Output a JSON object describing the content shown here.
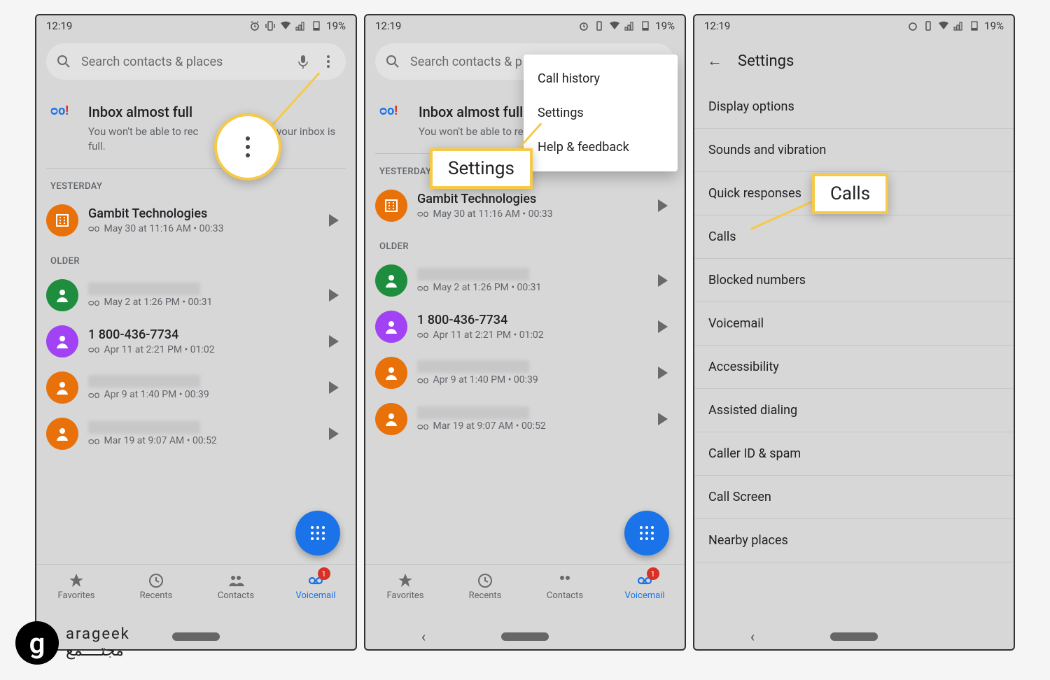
{
  "status": {
    "time": "12:19",
    "battery": "19%"
  },
  "search": {
    "placeholder": "Search contacts & places"
  },
  "notice": {
    "title": "Inbox almost full",
    "body1": "You won't be able to receive voicemail if your inbox is full.",
    "body1_cut": "You won't be able to rec",
    "body1_cut_tail": "mail if your inbox is full.",
    "body1_cut2": "You won't be able to re"
  },
  "sections": {
    "yesterday": "YESTERDAY",
    "older": "OLDER"
  },
  "voicemails": [
    {
      "name": "Gambit Technologies",
      "meta": "May 30 at 11:16 AM • 00:33",
      "color": "#e8710a",
      "icon": "building"
    },
    {
      "redacted": true,
      "meta": "May 2 at 1:26 PM • 00:31",
      "color": "#1e8e3e",
      "icon": "person"
    },
    {
      "name": "1 800-436-7734",
      "meta": "Apr 11 at 2:21 PM • 01:02",
      "color": "#a142f4",
      "icon": "person"
    },
    {
      "redacted": true,
      "meta": "Apr 9 at 1:40 PM • 00:39",
      "color": "#e8710a",
      "icon": "person"
    },
    {
      "redacted": true,
      "meta": "Mar 19 at 9:07 AM • 00:52",
      "color": "#e8710a",
      "icon": "person"
    }
  ],
  "bottomnav": {
    "favorites": "Favorites",
    "recents": "Recents",
    "contacts": "Contacts",
    "voicemail": "Voicemail",
    "badge": "1"
  },
  "popup": {
    "call_history": "Call history",
    "settings": "Settings",
    "help": "Help & feedback"
  },
  "callouts": {
    "settings": "Settings",
    "calls": "Calls"
  },
  "settingsPage": {
    "title": "Settings",
    "items": [
      "Display options",
      "Sounds and vibration",
      "Quick responses",
      "Calls",
      "Blocked numbers",
      "Voicemail",
      "Accessibility",
      "Assisted dialing",
      "Caller ID & spam",
      "Call Screen",
      "Nearby places"
    ]
  },
  "watermark": {
    "g": "g",
    "line1": "arageek",
    "line2": "مجتــــمع"
  },
  "vm_glyph": "ᴑo"
}
